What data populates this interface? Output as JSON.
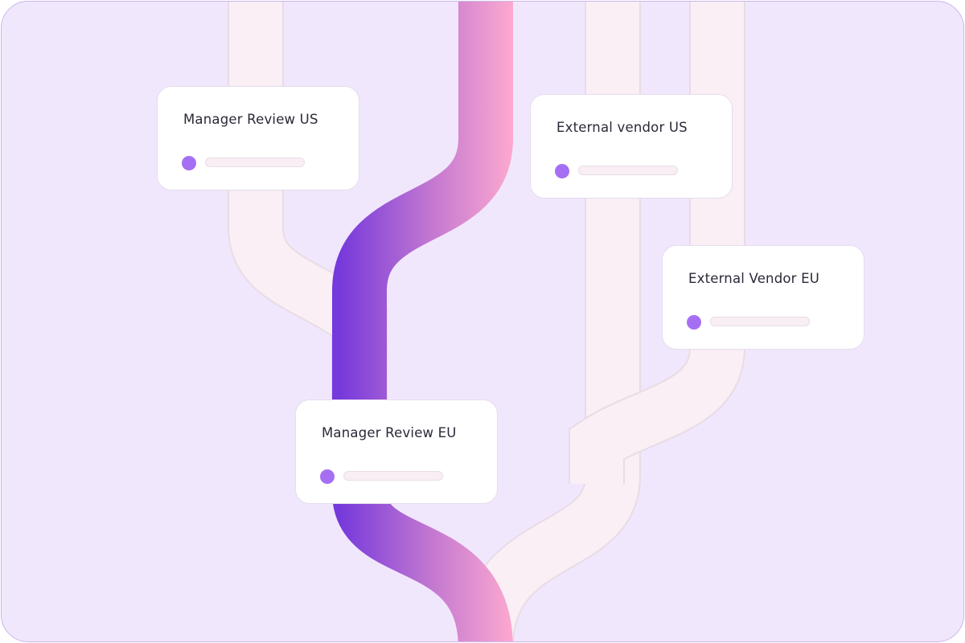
{
  "diagram": {
    "colors": {
      "background": "#f1e7fd",
      "frame_border": "#c9b6ee",
      "muted_flow": "#f9eff4",
      "muted_flow_edge": "#e8dce5",
      "active_flow_start": "#7639db",
      "active_flow_end": "#ffabcf",
      "status_dot": "#a66ff3",
      "card_background": "#ffffff",
      "card_text": "#2c2838"
    },
    "cards": {
      "manager_us": {
        "title": "Manager Review US"
      },
      "external_us": {
        "title": "External vendor US"
      },
      "external_eu": {
        "title": "External Vendor EU"
      },
      "manager_eu": {
        "title": "Manager Review EU"
      }
    },
    "active_path": [
      "manager_eu"
    ]
  }
}
